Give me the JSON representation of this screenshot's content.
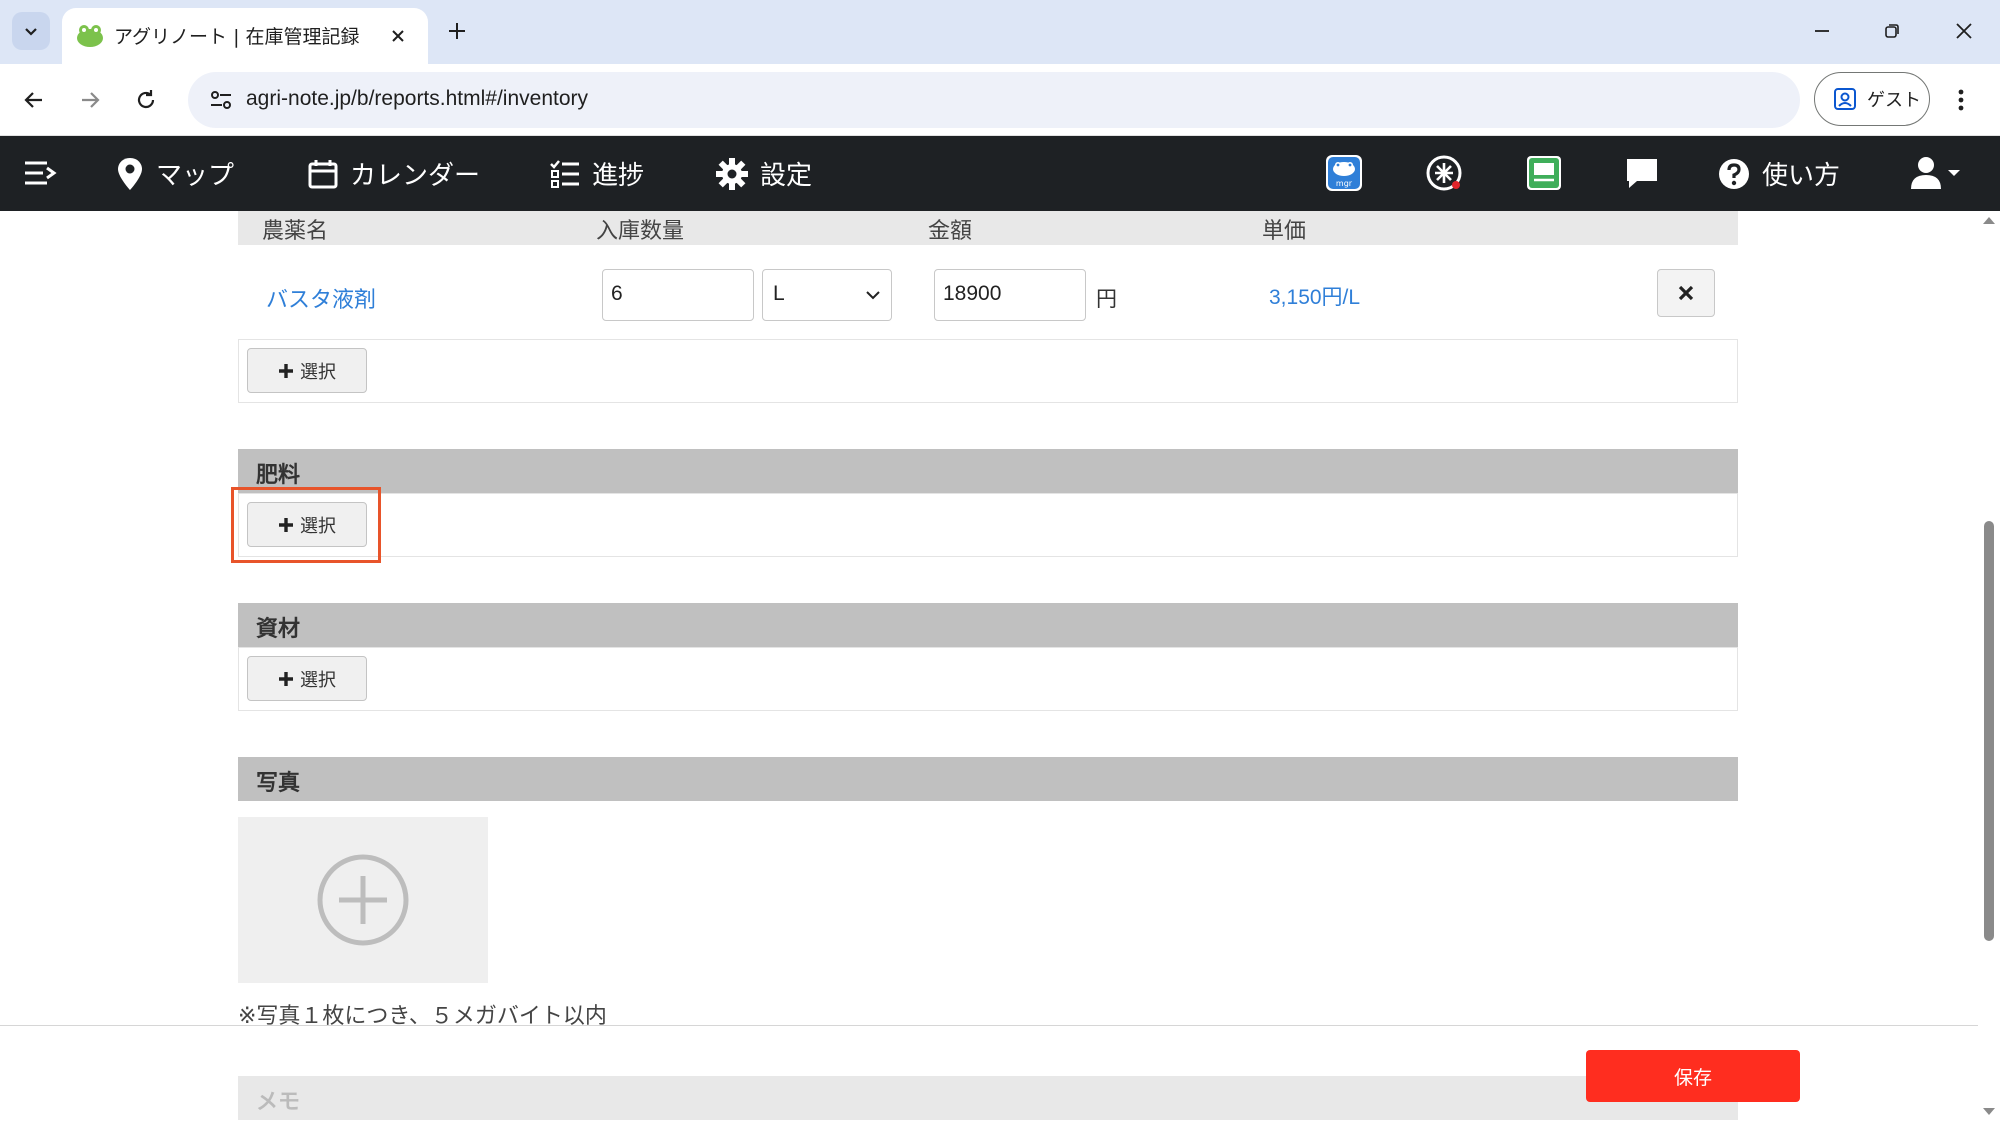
{
  "browser": {
    "tab_title": "アグリノート | 在庫管理記録",
    "url": "agri-note.jp/b/reports.html#/inventory",
    "guest_label": "ゲスト"
  },
  "appnav": {
    "items": [
      {
        "label": "マップ"
      },
      {
        "label": "カレンダー"
      },
      {
        "label": "進捗"
      },
      {
        "label": "設定"
      }
    ],
    "help_label": "使い方",
    "mgr_label": "mgr"
  },
  "pesticide_table": {
    "headers": [
      "農薬名",
      "入庫数量",
      "金額",
      "単価"
    ],
    "rows": [
      {
        "name": "バスタ液剤",
        "quantity": "6",
        "unit": "L",
        "amount": "18900",
        "yen": "円",
        "unit_price": "3,150円/L"
      }
    ],
    "select_label": "選択"
  },
  "sections": {
    "fertilizer": {
      "title": "肥料",
      "select_label": "選択"
    },
    "materials": {
      "title": "資材",
      "select_label": "選択"
    },
    "photo": {
      "title": "写真",
      "note": "※写真１枚につき、５メガバイト以内"
    },
    "memo": {
      "title": "メモ"
    }
  },
  "save_label": "保存",
  "colors": {
    "accent_link": "#2f7fd8",
    "save": "#ff2d1f",
    "highlight": "#e8542a",
    "nav_bg": "#1e2124"
  }
}
